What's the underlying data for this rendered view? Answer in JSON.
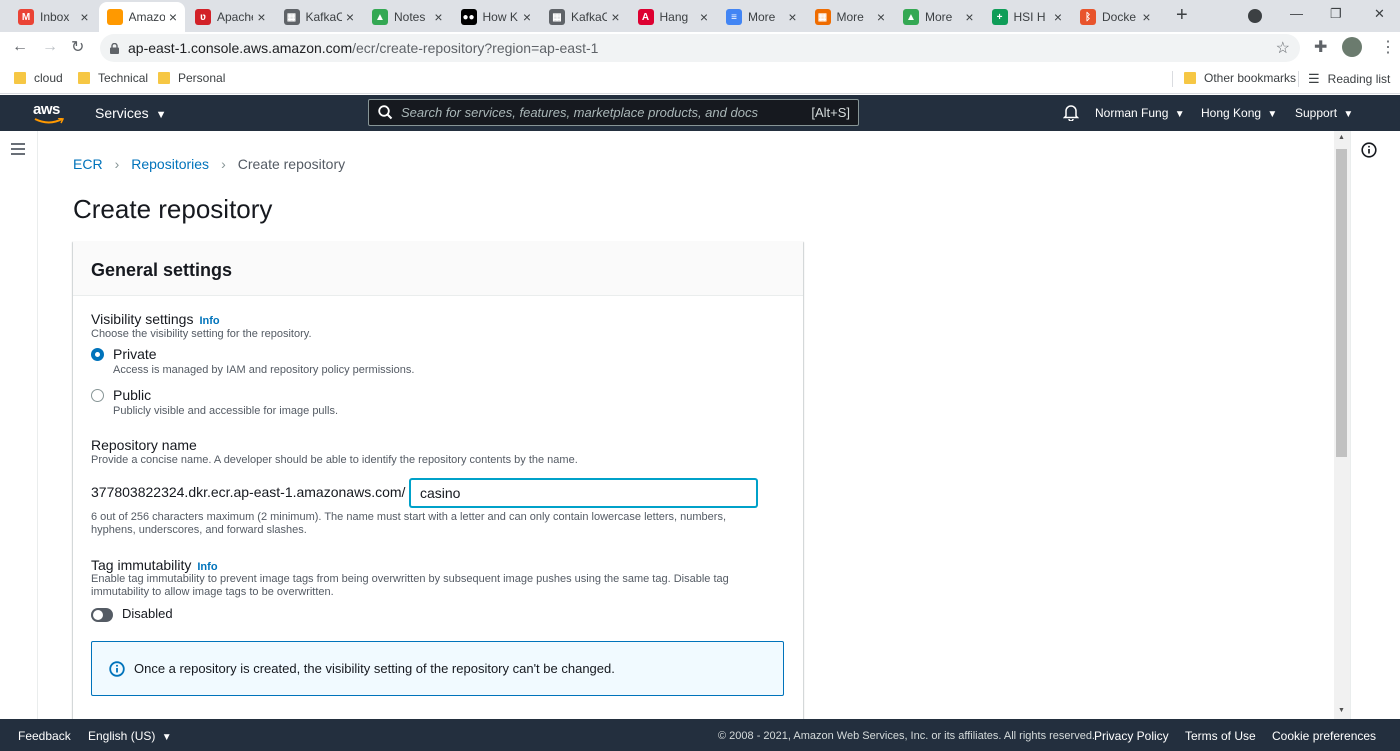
{
  "browser": {
    "tabs": [
      {
        "title": "Inbox",
        "favicon": "gmail-icon",
        "color": "#ea4335",
        "glyph": "M"
      },
      {
        "title": "Amazon",
        "favicon": "aws-icon",
        "color": "#ff9900",
        "glyph": ""
      },
      {
        "title": "Apache",
        "favicon": "apache-icon",
        "color": "#d22128",
        "glyph": "ʋ"
      },
      {
        "title": "KafkaC",
        "favicon": "sheet-icon",
        "color": "#5f6368",
        "glyph": "▦"
      },
      {
        "title": "Notes",
        "favicon": "drive-icon",
        "color": "#34a853",
        "glyph": "▲"
      },
      {
        "title": "How K",
        "favicon": "medium-icon",
        "color": "#000000",
        "glyph": "●●"
      },
      {
        "title": "KafkaC",
        "favicon": "sheet-icon",
        "color": "#5f6368",
        "glyph": "▦"
      },
      {
        "title": "Hang",
        "favicon": "angular-icon",
        "color": "#dd0031",
        "glyph": "A"
      },
      {
        "title": "More",
        "favicon": "docs-icon",
        "color": "#4285f4",
        "glyph": "≡"
      },
      {
        "title": "More",
        "favicon": "orange-icon",
        "color": "#ef6c00",
        "glyph": "▦"
      },
      {
        "title": "More",
        "favicon": "drive-icon",
        "color": "#34a853",
        "glyph": "▲"
      },
      {
        "title": "HSI H",
        "favicon": "sheets-icon",
        "color": "#0f9d58",
        "glyph": "+"
      },
      {
        "title": "Docke",
        "favicon": "docker-icon",
        "color": "#e8542c",
        "glyph": "ᛒ"
      }
    ],
    "new_tab": "+",
    "url_domain": "ap-east-1.console.aws.amazon.com",
    "url_path": "/ecr/create-repository?region=ap-east-1",
    "bookmarks": [
      "cloud",
      "Technical",
      "Personal"
    ],
    "other_bookmarks": "Other bookmarks",
    "reading_list": "Reading list"
  },
  "aws_nav": {
    "logo": "aws",
    "services": "Services",
    "search_placeholder": "Search for services, features, marketplace products, and docs",
    "search_shortcut": "[Alt+S]",
    "user": "Norman Fung",
    "region": "Hong Kong",
    "support": "Support"
  },
  "breadcrumb": {
    "items": [
      "ECR",
      "Repositories",
      "Create repository"
    ]
  },
  "page_title": "Create repository",
  "general_settings": {
    "heading": "General settings",
    "visibility": {
      "label": "Visibility settings",
      "info": "Info",
      "description": "Choose the visibility setting for the repository.",
      "options": [
        {
          "label": "Private",
          "description": "Access is managed by IAM and repository policy permissions.",
          "selected": true
        },
        {
          "label": "Public",
          "description": "Publicly visible and accessible for image pulls.",
          "selected": false
        }
      ]
    },
    "repo_name": {
      "label": "Repository name",
      "description": "Provide a concise name. A developer should be able to identify the repository contents by the name.",
      "prefix": "377803822324.dkr.ecr.ap-east-1.amazonaws.com/",
      "value": "casino",
      "hint": "6 out of 256 characters maximum (2 minimum). The name must start with a letter and can only contain lowercase letters, numbers, hyphens, underscores, and forward slashes."
    },
    "tag_immutability": {
      "label": "Tag immutability",
      "info": "Info",
      "description": "Enable tag immutability to prevent image tags from being overwritten by subsequent image pushes using the same tag. Disable tag immutability to allow image tags to be overwritten.",
      "state": "Disabled"
    },
    "alert": "Once a repository is created, the visibility setting of the repository can't be changed."
  },
  "footer": {
    "feedback": "Feedback",
    "language": "English (US)",
    "copyright": "© 2008 - 2021, Amazon Web Services, Inc. or its affiliates. All rights reserved.",
    "privacy": "Privacy Policy",
    "terms": "Terms of Use",
    "cookies": "Cookie preferences"
  },
  "colors": {
    "aws_nav_bg": "#232f3e",
    "link": "#0073bb",
    "focus": "#00a1c9"
  }
}
